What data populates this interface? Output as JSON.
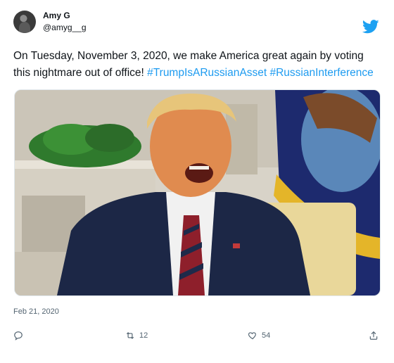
{
  "author": {
    "display_name": "Amy G",
    "handle": "@amyg__g"
  },
  "tweet": {
    "text": "On Tuesday, November 3, 2020, we make America great again by voting this nightmare out of office!",
    "hashtags": [
      "#TrumpIsARussianAsset",
      "#RussianInterference"
    ],
    "date": "Feb 21, 2020"
  },
  "actions": {
    "reply_count": "",
    "retweet_count": "12",
    "like_count": "54"
  },
  "colors": {
    "link": "#1d9bf0",
    "twitter_blue": "#1da1f2",
    "muted": "#536471"
  },
  "icons": [
    "twitter-bird-icon",
    "reply-icon",
    "retweet-icon",
    "like-icon",
    "share-icon"
  ]
}
